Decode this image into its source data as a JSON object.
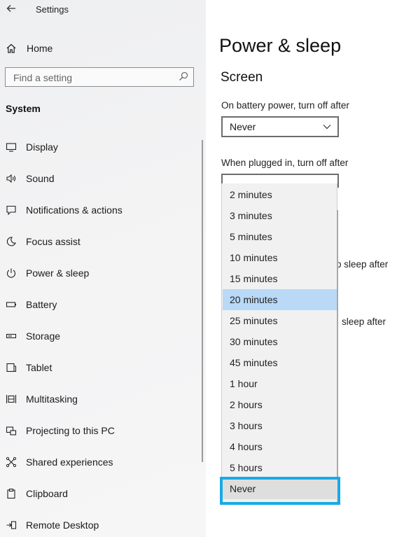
{
  "window": {
    "title": "Settings",
    "back_icon": "back-arrow-icon"
  },
  "sidebar": {
    "home_label": "Home",
    "search_placeholder": "Find a setting",
    "section": "System",
    "items": [
      {
        "label": "Display",
        "icon": "display-icon"
      },
      {
        "label": "Sound",
        "icon": "sound-icon"
      },
      {
        "label": "Notifications & actions",
        "icon": "notifications-icon"
      },
      {
        "label": "Focus assist",
        "icon": "focus-assist-icon"
      },
      {
        "label": "Power & sleep",
        "icon": "power-icon"
      },
      {
        "label": "Battery",
        "icon": "battery-icon"
      },
      {
        "label": "Storage",
        "icon": "storage-icon"
      },
      {
        "label": "Tablet",
        "icon": "tablet-icon"
      },
      {
        "label": "Multitasking",
        "icon": "multitasking-icon"
      },
      {
        "label": "Projecting to this PC",
        "icon": "projecting-icon"
      },
      {
        "label": "Shared experiences",
        "icon": "shared-experiences-icon"
      },
      {
        "label": "Clipboard",
        "icon": "clipboard-icon"
      },
      {
        "label": "Remote Desktop",
        "icon": "remote-desktop-icon"
      }
    ]
  },
  "main": {
    "title": "Power & sleep",
    "screen_heading": "Screen",
    "battery_label": "On battery power, turn off after",
    "battery_value": "Never",
    "plugged_label": "When plugged in, turn off after",
    "partial_sleep_1": "o sleep after",
    "partial_sleep_2": "sleep after"
  },
  "dropdown": {
    "options": [
      "2 minutes",
      "3 minutes",
      "5 minutes",
      "10 minutes",
      "15 minutes",
      "20 minutes",
      "25 minutes",
      "30 minutes",
      "45 minutes",
      "1 hour",
      "2 hours",
      "3 hours",
      "4 hours",
      "5 hours",
      "Never"
    ],
    "hovered": "20 minutes",
    "selected": "Never",
    "highlight_color": "#b9d9f7",
    "frame_color": "#19a9e6"
  }
}
